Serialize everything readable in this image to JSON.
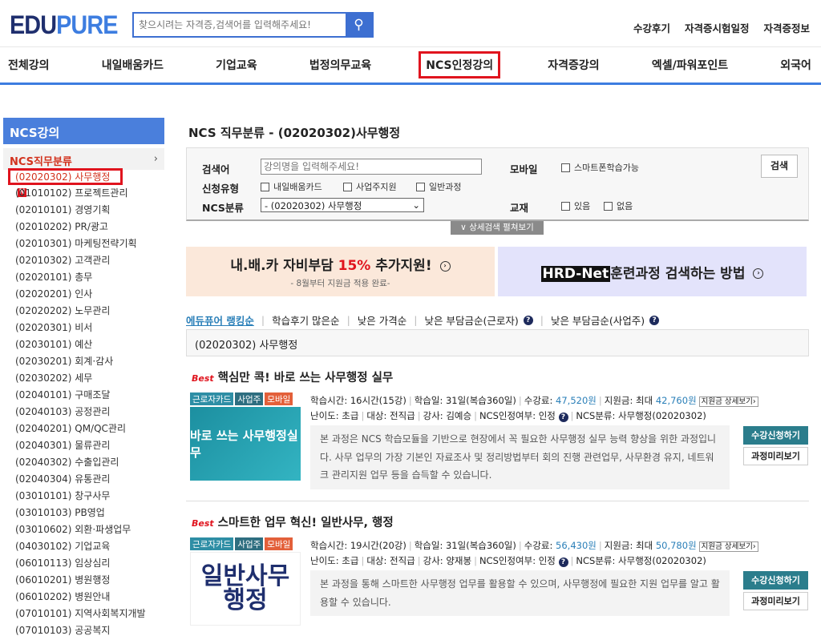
{
  "header": {
    "logo_a": "EDU",
    "logo_b": "PURE",
    "search_placeholder": "찾으시려는 자격증,검색어를 입력해주세요!",
    "links": [
      "수강후기",
      "자격증시험일정",
      "자격증정보"
    ]
  },
  "nav": [
    "전체강의",
    "내일배움카드",
    "기업교육",
    "법정의무교육",
    "NCS인정강의",
    "자격증강의",
    "엑셀/파워포인트",
    "외국어"
  ],
  "sidebar": {
    "title": "NCS강의",
    "category": "NCS직무분류",
    "chevron": "›",
    "new_badge": "N",
    "items": [
      "(02020302) 사무행정",
      "(01010102) 프로젝트관리",
      "(02010101) 경영기획",
      "(02010202) PR/광고",
      "(02010301) 마케팅전략기획",
      "(02010302) 고객관리",
      "(02020101) 총무",
      "(02020201) 인사",
      "(02020202) 노무관리",
      "(02020301) 비서",
      "(02030101) 예산",
      "(02030201) 회계·감사",
      "(02030202) 세무",
      "(02040101) 구매조달",
      "(02040103) 공정관리",
      "(02040201) QM/QC관리",
      "(02040301) 물류관리",
      "(02040302) 수출입관리",
      "(02040304) 유통관리",
      "(03010101) 창구사무",
      "(03010103) PB영업",
      "(03010602) 외환·파생업무",
      "(04030102) 기업교육",
      "(06010113) 임상심리",
      "(06010201) 병원행정",
      "(06010202) 병원안내",
      "(07010101) 지역사회복지개발",
      "(07010103) 공공복지"
    ]
  },
  "main": {
    "title": "NCS 직무분류 - (02020302)사무행정",
    "search": {
      "kw_label": "검색어",
      "kw_placeholder": "강의명을 입력해주세요!",
      "type_label": "신청유형",
      "types": [
        "내일배움카드",
        "사업주지원",
        "일반과정"
      ],
      "ncs_label": "NCS분류",
      "ncs_value": "- (02020302) 사무행정",
      "mobile_label": "모바일",
      "mobile_opt": "스마트폰학습가능",
      "book_label": "교재",
      "book_opts": [
        "있음",
        "없음"
      ],
      "search_btn": "검색",
      "toggle": "∨ 상세검색 펼쳐보기"
    },
    "banners": {
      "b1_pre": "내.배.카 자비부담 ",
      "b1_pct": "15%",
      "b1_post": " 추가지원!",
      "b1_sub": "- 8월부터 지원금 적용 완료-",
      "b2_hrd": "HRD-Net",
      "b2_text": "훈련과정 검색하는 방법"
    },
    "sort": [
      "에듀퓨어 랭킹순",
      "학습후기 많은순",
      "낮은 가격순",
      "낮은 부담금순(근로자)",
      "낮은 부담금순(사업주)"
    ],
    "category_box": "(02020302) 사무행정",
    "courses": [
      {
        "best": "Best",
        "title": "핵심만 콕! 바로 쓰는 사무행정 실무",
        "badges": [
          "근로자카드",
          "사업주",
          "모바일"
        ],
        "thumb": "바로 쓰는 사무행정실무",
        "time": "학습시간: 16시간(15강)",
        "days": "학습일: 31일(복습360일)",
        "fee_label": "수강료: ",
        "fee": "47,520원",
        "sup_label": "지원금: 최대 ",
        "sup": "42,760원",
        "detail": "지원금 상세보기›",
        "level": "난이도: 초급",
        "target": "대상: 전직급",
        "teacher": "강사: 김예승",
        "ncs_ok": "NCS인정여부: 인정",
        "ncs_cat": "NCS분류: 사무행정(02020302)",
        "desc": "본 과정은 NCS 학습모듈을 기반으로 현장에서 꼭 필요한 사무행정 실무 능력 향상을 위한 과정입니다. 사무 업무의 가장 기본인 자료조사 및 정리방법부터 회의 진행 관련업무, 사무환경 유지, 네트워크 관리지원 업무 등을 습득할 수 있습니다.",
        "apply": "수강신청하기",
        "preview": "과정미리보기"
      },
      {
        "best": "Best",
        "title": "스마트한 업무 혁신! 일반사무, 행정",
        "badges": [
          "근로자카드",
          "사업주",
          "모바일"
        ],
        "thumb": "일반사무 행정",
        "time": "학습시간: 19시간(20강)",
        "days": "학습일: 31일(복습360일)",
        "fee_label": "수강료: ",
        "fee": "56,430원",
        "sup_label": "지원금: 최대 ",
        "sup": "50,780원",
        "detail": "지원금 상세보기›",
        "level": "난이도: 초급",
        "target": "대상: 전직급",
        "teacher": "강사: 양재봉",
        "ncs_ok": "NCS인정여부: 인정",
        "ncs_cat": "NCS분류: 사무행정(02020302)",
        "desc": "본 과정을 통해 스마트한 사무행정 업무를 활용할 수 있으며, 사무행정에 필요한 지원 업무를 알고 활용할 수 있습니다.",
        "apply": "수강신청하기",
        "preview": "과정미리보기"
      }
    ]
  }
}
